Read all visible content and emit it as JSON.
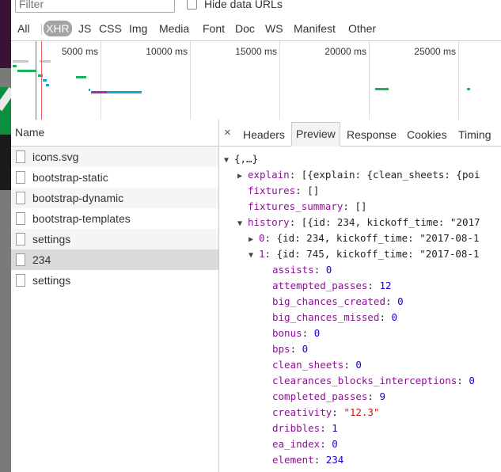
{
  "filter": {
    "placeholder": "Filter",
    "hide_data_urls_label": "Hide data URLs"
  },
  "types": [
    "All",
    "XHR",
    "JS",
    "CSS",
    "Img",
    "Media",
    "Font",
    "Doc",
    "WS",
    "Manifest",
    "Other"
  ],
  "active_type": "XHR",
  "timeline": {
    "ticks": [
      "5000 ms",
      "10000 ms",
      "15000 ms",
      "20000 ms",
      "25000 ms"
    ]
  },
  "colors": {
    "bar_green": "#1ab05f",
    "bar_teal": "#16a3d6",
    "bar_purple": "#a02ea5",
    "bar_gray": "#c9c9c9",
    "line_red": "#e06060",
    "line_blue": "#4a6ef0"
  },
  "requests": {
    "header": "Name",
    "items": [
      "icons.svg",
      "bootstrap-static",
      "bootstrap-dynamic",
      "bootstrap-templates",
      "settings",
      "234",
      "settings"
    ],
    "selected_index": 5
  },
  "detail": {
    "close": "×",
    "tabs": [
      "Headers",
      "Preview",
      "Response",
      "Cookies",
      "Timing"
    ],
    "active_tab": "Preview"
  },
  "preview": {
    "root": "{,…}",
    "explain_key": "explain",
    "explain_val": "[{explain: {clean_sheets: {poi",
    "fixtures_key": "fixtures",
    "fixtures_val": "[]",
    "fixtures_summary_key": "fixtures_summary",
    "fixtures_summary_val": "[]",
    "history_key": "history",
    "history_val": "[{id: 234, kickoff_time: \"2017",
    "item0_key": "0",
    "item0_val": "{id: 234, kickoff_time: \"2017-08-1",
    "item1_key": "1",
    "item1_val": "{id: 745, kickoff_time: \"2017-08-1",
    "fields": [
      {
        "key": "assists",
        "value": "0",
        "type": "number"
      },
      {
        "key": "attempted_passes",
        "value": "12",
        "type": "number"
      },
      {
        "key": "big_chances_created",
        "value": "0",
        "type": "number"
      },
      {
        "key": "big_chances_missed",
        "value": "0",
        "type": "number"
      },
      {
        "key": "bonus",
        "value": "0",
        "type": "number"
      },
      {
        "key": "bps",
        "value": "0",
        "type": "number"
      },
      {
        "key": "clean_sheets",
        "value": "0",
        "type": "number"
      },
      {
        "key": "clearances_blocks_interceptions",
        "value": "0",
        "type": "number"
      },
      {
        "key": "completed_passes",
        "value": "9",
        "type": "number"
      },
      {
        "key": "creativity",
        "value": "\"12.3\"",
        "type": "string"
      },
      {
        "key": "dribbles",
        "value": "1",
        "type": "number"
      },
      {
        "key": "ea_index",
        "value": "0",
        "type": "number"
      },
      {
        "key": "element",
        "value": "234",
        "type": "number"
      }
    ]
  }
}
